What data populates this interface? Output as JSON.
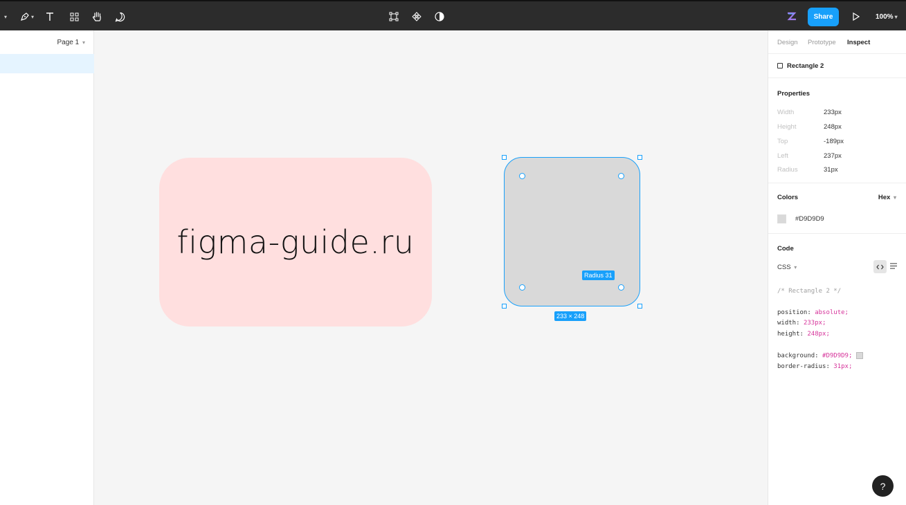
{
  "toolbar": {
    "share_label": "Share",
    "zoom_label": "100%"
  },
  "left_panel": {
    "page_label": "Page 1"
  },
  "canvas": {
    "card_text": "figma-guide.ru",
    "radius_badge": "Radius 31",
    "size_badge": "233 × 248",
    "selection_color": "#18A0FB",
    "card_color": "#FFDFDF",
    "rect_color": "#D9D9D9"
  },
  "inspect": {
    "tabs": [
      "Design",
      "Prototype",
      "Inspect"
    ],
    "active_tab": "Inspect",
    "layer_name": "Rectangle 2",
    "properties_title": "Properties",
    "properties": [
      {
        "label": "Width",
        "value": "233px"
      },
      {
        "label": "Height",
        "value": "248px"
      },
      {
        "label": "Top",
        "value": "-189px"
      },
      {
        "label": "Left",
        "value": "237px"
      },
      {
        "label": "Radius",
        "value": "31px"
      }
    ],
    "colors_title": "Colors",
    "color_format": "Hex",
    "color_value": "#D9D9D9",
    "code_title": "Code",
    "code_lang": "CSS",
    "code_comment": "/* Rectangle 2 */",
    "code_lines": [
      {
        "prop": "position:",
        "val": "absolute;"
      },
      {
        "prop": "width:",
        "val": "233px;"
      },
      {
        "prop": "height:",
        "val": "248px;"
      },
      {
        "prop": "background:",
        "val": "#D9D9D9;"
      },
      {
        "prop": "border-radius:",
        "val": "31px;"
      }
    ]
  },
  "help_label": "?"
}
